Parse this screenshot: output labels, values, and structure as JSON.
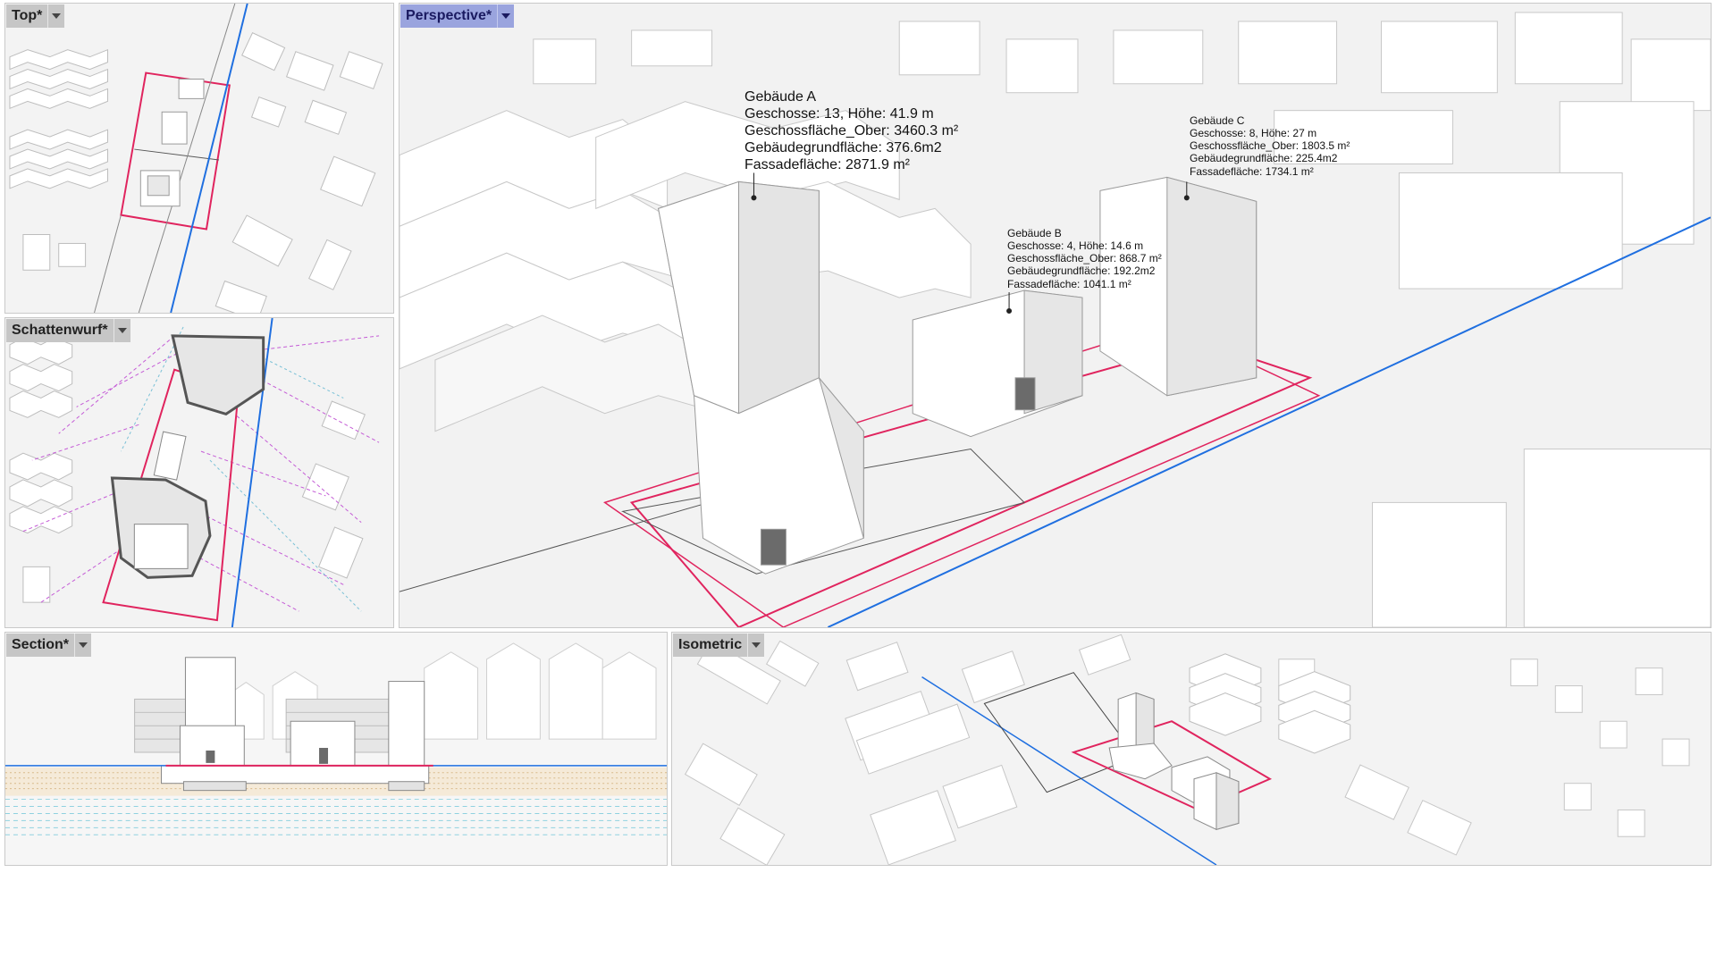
{
  "viewports": {
    "top": {
      "title": "Top*"
    },
    "schattenwurf": {
      "title": "Schattenwurf*"
    },
    "perspective": {
      "title": "Perspective*"
    },
    "section": {
      "title": "Section*"
    },
    "isometric": {
      "title": "Isometric"
    }
  },
  "buildings": {
    "a": {
      "name": "Gebäude A",
      "floors": "Geschosse: 13, Höhe: 41.9 m",
      "floor_area": "Geschossfläche_Ober: 3460.3 m²",
      "ground_area": "Gebäudegrundfläche: 376.6m2",
      "facade_area": "Fassadefläche: 2871.9 m²"
    },
    "b": {
      "name": "Gebäude B",
      "floors": "Geschosse: 4, Höhe: 14.6 m",
      "floor_area": "Geschossfläche_Ober: 868.7 m²",
      "ground_area": "Gebäudegrundfläche: 192.2m2",
      "facade_area": "Fassadefläche: 1041.1 m²"
    },
    "c": {
      "name": "Gebäude C",
      "floors": "Geschosse: 8, Höhe: 27 m",
      "floor_area": "Geschossfläche_Ober: 1803.5 m²",
      "ground_area": "Gebäudegrundfläche: 225.4m2",
      "facade_area": "Fassadefläche: 1734.1 m²"
    }
  },
  "colors": {
    "active_tab": "#9aa4de",
    "inactive_tab": "#c6c6c6",
    "site_boundary": "#e0245e",
    "road_line": "#1f6fe0",
    "building_face": "#ffffff",
    "building_shade": "#dcdcdc"
  },
  "icons": {
    "viewport_menu": "chevron-down-icon"
  }
}
